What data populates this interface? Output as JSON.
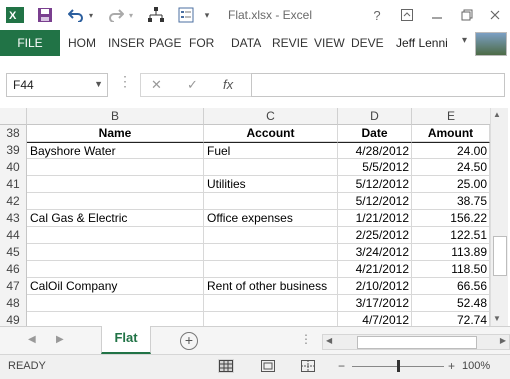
{
  "titlebar": {
    "title": "Flat.xlsx - Excel",
    "help_label": "?",
    "icons": [
      "excel-logo-icon",
      "save-icon",
      "undo-icon",
      "undo-dropdown-icon",
      "redo-icon",
      "redo-dropdown-icon",
      "org-chart-icon",
      "form-icon",
      "customize-quick-access-icon"
    ]
  },
  "ribbon": {
    "file_label": "FILE",
    "tabs": [
      "HOM",
      "INSER",
      "PAGE",
      "FOR",
      "DATA",
      "REVIE",
      "VIEW",
      "DEVE"
    ],
    "user_name": "Jeff Lenni"
  },
  "formula_bar": {
    "name_box": "F44",
    "fx_label": "fx",
    "formula": ""
  },
  "grid": {
    "columns": [
      "B",
      "C",
      "D",
      "E"
    ],
    "rows": [
      {
        "row": "38",
        "b": "Name",
        "c": "Account",
        "d": "Date",
        "e": "Amount",
        "header": true
      },
      {
        "row": "39",
        "b": "Bayshore Water",
        "c": "Fuel",
        "d": "4/28/2012",
        "e": "24.00"
      },
      {
        "row": "40",
        "b": "",
        "c": "",
        "d": "5/5/2012",
        "e": "24.50"
      },
      {
        "row": "41",
        "b": "",
        "c": "Utilities",
        "d": "5/12/2012",
        "e": "25.00"
      },
      {
        "row": "42",
        "b": "",
        "c": "",
        "d": "5/12/2012",
        "e": "38.75"
      },
      {
        "row": "43",
        "b": "Cal Gas & Electric",
        "c": "Office expenses",
        "d": "1/21/2012",
        "e": "156.22"
      },
      {
        "row": "44",
        "b": "",
        "c": "",
        "d": "2/25/2012",
        "e": "122.51"
      },
      {
        "row": "45",
        "b": "",
        "c": "",
        "d": "3/24/2012",
        "e": "113.89"
      },
      {
        "row": "46",
        "b": "",
        "c": "",
        "d": "4/21/2012",
        "e": "118.50"
      },
      {
        "row": "47",
        "b": "CalOil Company",
        "c": "Rent of other business",
        "d": "2/10/2012",
        "e": "66.56"
      },
      {
        "row": "48",
        "b": "",
        "c": "",
        "d": "3/17/2012",
        "e": "52.48"
      },
      {
        "row": "49",
        "b": "",
        "c": "",
        "d": "4/7/2012",
        "e": "72.74"
      }
    ]
  },
  "sheet_tabs": {
    "active": "Flat",
    "add_label": "+"
  },
  "statusbar": {
    "status": "READY",
    "zoom_minus": "−",
    "zoom_plus": "+",
    "zoom": "100%",
    "zoom_fraction": 0.5
  },
  "colors": {
    "accent": "#217346"
  }
}
